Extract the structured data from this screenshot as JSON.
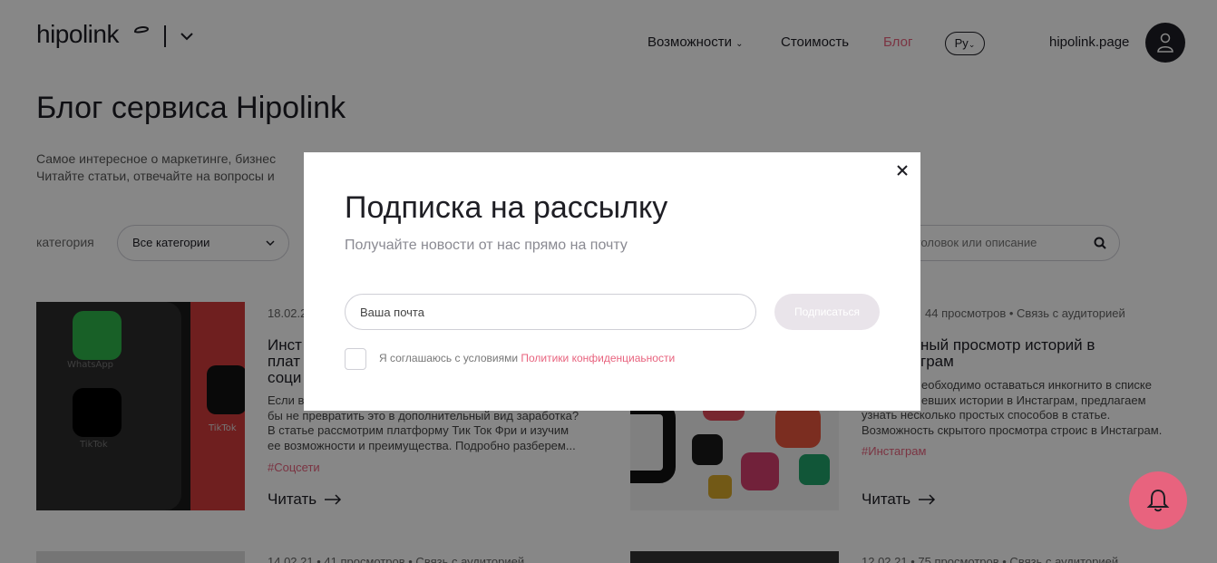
{
  "header": {
    "logo_text": "hipolink",
    "nav": [
      {
        "label": "Возможности"
      },
      {
        "label": "Стоимость"
      },
      {
        "label": "Блог"
      }
    ],
    "lang": "Ру",
    "site_link": "hipolink.page"
  },
  "page": {
    "title": "Блог сервиса Hipolink",
    "subtitle_line1": "Самое интересное о маркетинге, бизнес",
    "subtitle_line2": "Читайте статьи, отвечайте на вопросы и",
    "category_label": "категория",
    "category_value": "Все категории",
    "search_placeholder": "головок или описание"
  },
  "cards": [
    {
      "date": "18.02.2",
      "title_l1": "Инст",
      "title_l2": "плат",
      "title_l3": "соци",
      "desc_l1": "Если в",
      "desc_l2": "бы не превратить это в дополнительный вид заработка?",
      "desc_l3": "В статье рассмотрим платформу Тик Ток Фри и изучим",
      "desc_l4": "ее возможности и преимущества. Подробно разберем...",
      "tag": "#Соцсети",
      "read": "Читать",
      "img_labels": [
        "WhatsApp",
        "TikTok",
        "TikTok"
      ]
    },
    {
      "meta": "44 просмотров  •  Связь с аудиторией",
      "title_l1": "ный просмотр историй в",
      "title_l2": "грам",
      "desc_l1": "еобходимо оставаться инкогнито в списке",
      "desc_l2": "евших истории в Инстаграм, предлагаем",
      "desc_l3": "узнать несколько простых способов в статье.",
      "desc_l4": "Возможность скрытого просмотра строис в Инстаграм.",
      "tag": "#Инстаграм",
      "read": "Читать"
    }
  ],
  "bottom_meta": [
    "14.02.21  •  41 просмотров  •  Связь с аудиторией",
    "12.02.21  •  75 просмотров  •  Связь с аудиторией"
  ],
  "modal": {
    "title": "Подписка на рассылку",
    "subtitle": "Получайте новости от нас прямо на почту",
    "email_placeholder": "Ваша почта",
    "subscribe_label": "Подписаться",
    "agree_text": "Я соглашаюсь с условиями ",
    "agree_link": "Политики конфиденциаьности"
  },
  "colors": {
    "accent": "#e8637e",
    "dark": "#1e1e24",
    "overlay": "rgba(0,0,0,0.47)"
  }
}
